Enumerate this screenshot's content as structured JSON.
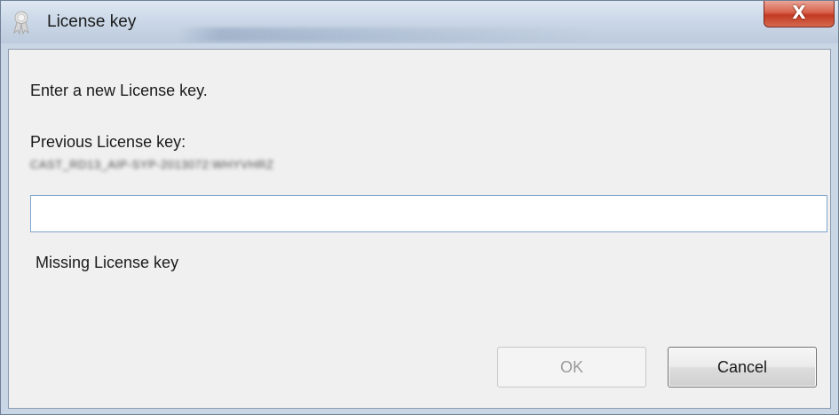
{
  "window": {
    "title": "License key",
    "close_label": "X"
  },
  "dialog": {
    "prompt": "Enter a new License key.",
    "previous_label": "Previous License key:",
    "previous_value": "CAST_RD13_AIP-SYP-2013072:WHYVHRZ",
    "input_value": "",
    "error_text": "Missing License key"
  },
  "buttons": {
    "ok_label": "OK",
    "cancel_label": "Cancel"
  },
  "icons": {
    "app": "ribbon-award-icon",
    "close": "close-icon"
  },
  "colors": {
    "close_button": "#c94a33",
    "input_border": "#7fa6cf",
    "disabled_text": "#9a9a9a"
  }
}
